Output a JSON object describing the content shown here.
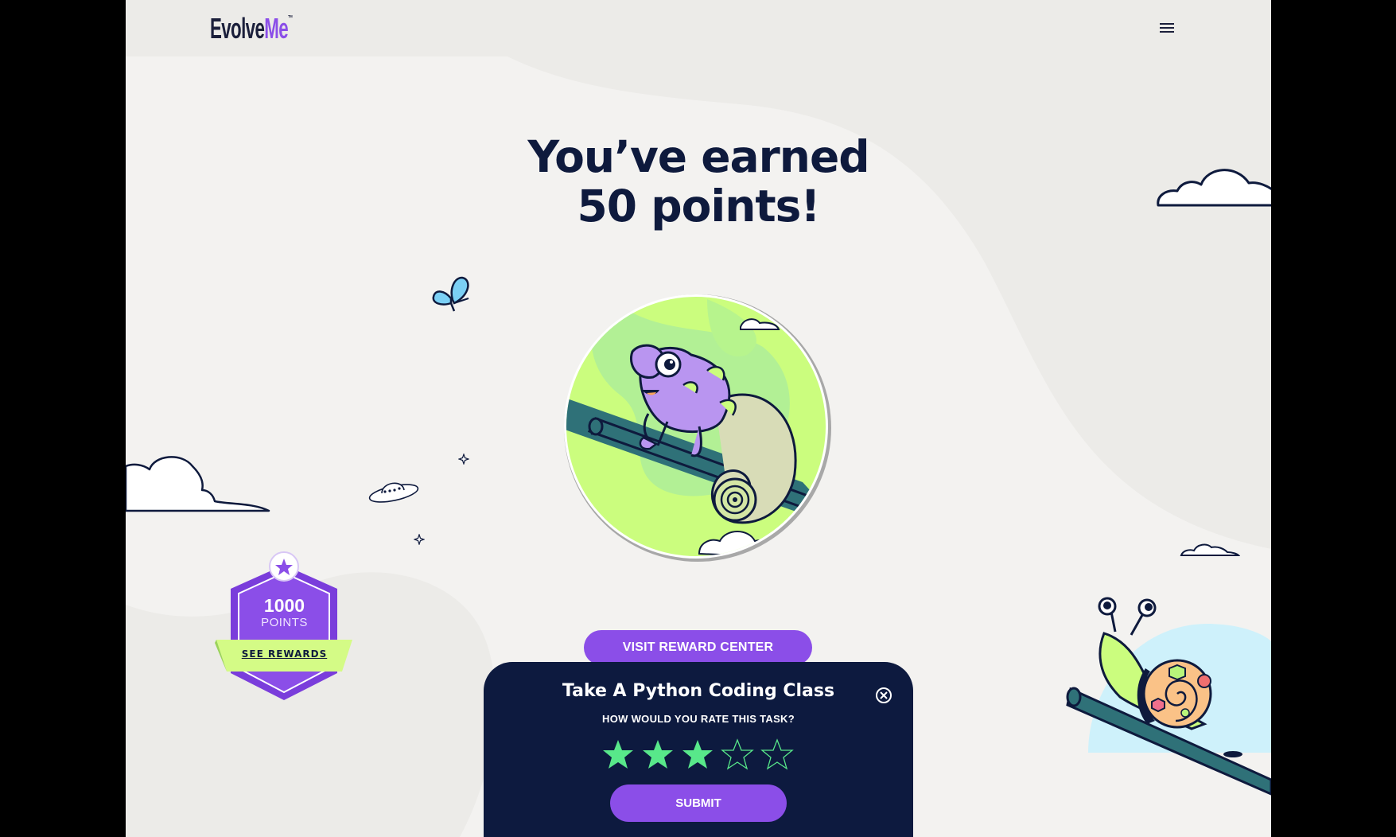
{
  "brand": {
    "logo_main": "Evolve",
    "logo_accent": "Me",
    "logo_tm": "™"
  },
  "header": {
    "menu_icon": "hamburger-menu-icon"
  },
  "headline": {
    "line1": "You’ve earned",
    "line2": "50 points!"
  },
  "reward_button": {
    "label": "VISIT REWARD CENTER"
  },
  "points_badge": {
    "value": "1000",
    "label": "POINTS",
    "link": "SEE REWARDS",
    "icon": "star-icon"
  },
  "rating_modal": {
    "title": "Take A Python Coding Class",
    "question": "HOW WOULD YOU RATE THIS TASK?",
    "rating": 3,
    "max_rating": 5,
    "submit_label": "SUBMIT",
    "close_icon": "close-circle-icon"
  },
  "colors": {
    "primary": "#8b4ee8",
    "navy": "#0d1a3f",
    "lime": "#d4fb86",
    "star_filled": "#58e88a",
    "background": "#ecebe8"
  }
}
